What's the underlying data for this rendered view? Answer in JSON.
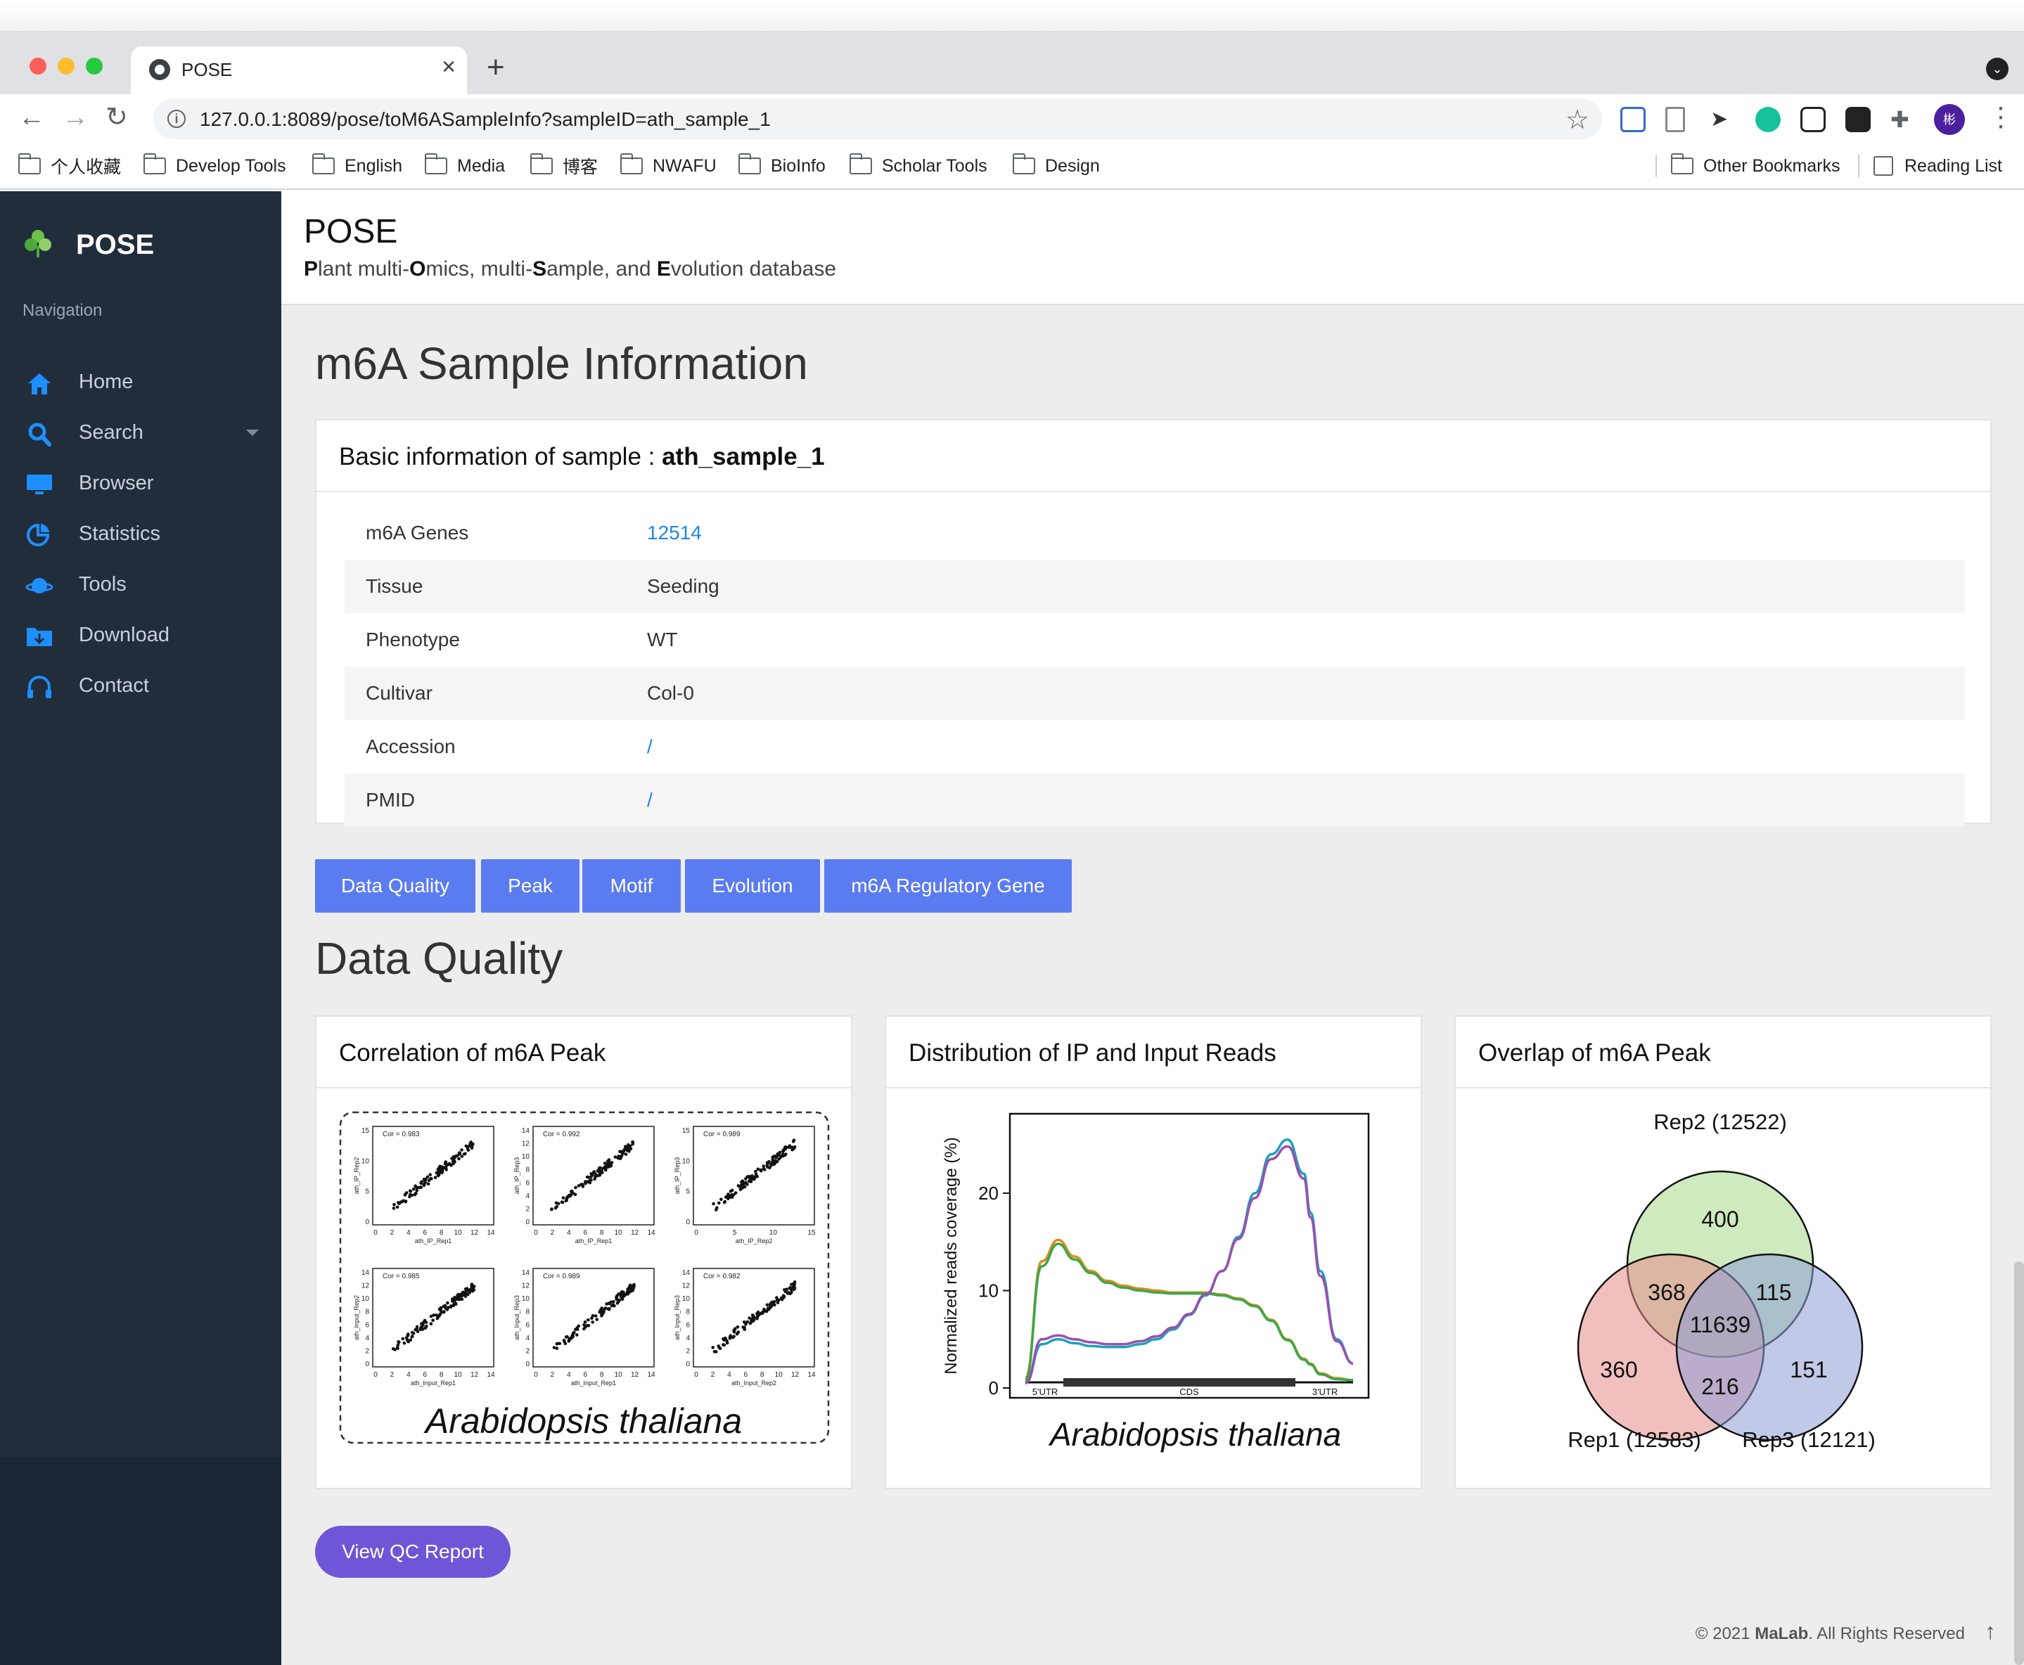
{
  "browser": {
    "tab_title": "POSE",
    "tab_close": "×",
    "new_tab": "+",
    "url": "127.0.0.1:8089/pose/toM6ASampleInfo?sampleID=ath_sample_1",
    "bookmarks": [
      "个人收藏",
      "Develop Tools",
      "English",
      "Media",
      "博客",
      "NWAFU",
      "BioInfo",
      "Scholar Tools",
      "Design"
    ],
    "other_bookmarks": "Other Bookmarks",
    "reading_list": "Reading List",
    "profile_initial": "彬"
  },
  "sidebar": {
    "brand": "POSE",
    "nav_heading": "Navigation",
    "items": [
      {
        "label": "Home",
        "icon": "home-icon"
      },
      {
        "label": "Search",
        "icon": "search-icon"
      },
      {
        "label": "Browser",
        "icon": "monitor-icon"
      },
      {
        "label": "Statistics",
        "icon": "pie-chart-icon"
      },
      {
        "label": "Tools",
        "icon": "planet-icon"
      },
      {
        "label": "Download",
        "icon": "download-icon"
      },
      {
        "label": "Contact",
        "icon": "headphones-icon"
      }
    ]
  },
  "header": {
    "title": "POSE",
    "subtitle_parts": [
      {
        "text": "P",
        "bold": true
      },
      {
        "text": "lant multi-",
        "bold": false
      },
      {
        "text": "O",
        "bold": true
      },
      {
        "text": "mics, multi-",
        "bold": false
      },
      {
        "text": "S",
        "bold": true
      },
      {
        "text": "ample, and ",
        "bold": false
      },
      {
        "text": "E",
        "bold": true
      },
      {
        "text": "volution database",
        "bold": false
      }
    ]
  },
  "page": {
    "title": "m6A Sample Information",
    "info_card_title_prefix": "Basic information of sample : ",
    "sample_id": "ath_sample_1",
    "rows": [
      {
        "key": "m6A Genes",
        "value": "12514",
        "link": true
      },
      {
        "key": "Tissue",
        "value": "Seeding",
        "link": false
      },
      {
        "key": "Phenotype",
        "value": "WT",
        "link": false
      },
      {
        "key": "Cultivar",
        "value": "Col-0",
        "link": false
      },
      {
        "key": "Accession",
        "value": "/",
        "link": true
      },
      {
        "key": "PMID",
        "value": "/",
        "link": true
      }
    ],
    "buttons": [
      "Data Quality",
      "Peak",
      "Motif",
      "Evolution",
      "m6A Regulatory Gene"
    ],
    "section_title": "Data Quality",
    "qc_button": "View QC Report"
  },
  "figures": {
    "correlation": {
      "card_title": "Correlation of m6A Peak",
      "species": "Arabidopsis thaliana",
      "panels": [
        {
          "cor": "Cor = 0.983",
          "xlabel": "ath_IP_Rep1",
          "ylabel": "ath_IP_Rep2",
          "xticks": [
            "0",
            "2",
            "4",
            "6",
            "8",
            "10",
            "12",
            "14"
          ],
          "yticks": [
            "15",
            "10",
            "5",
            "0"
          ]
        },
        {
          "cor": "Cor = 0.992",
          "xlabel": "ath_IP_Rep1",
          "ylabel": "ath_IP_Rep3",
          "xticks": [
            "0",
            "2",
            "4",
            "6",
            "8",
            "10",
            "12",
            "14"
          ],
          "yticks": [
            "14",
            "12",
            "10",
            "8",
            "6",
            "4",
            "2",
            "0"
          ]
        },
        {
          "cor": "Cor = 0.989",
          "xlabel": "ath_IP_Rep2",
          "ylabel": "ath_IP_Rep3",
          "xticks": [
            "0",
            "5",
            "10",
            "15"
          ],
          "yticks": [
            "15",
            "10",
            "5",
            "0"
          ]
        },
        {
          "cor": "Cor = 0.985",
          "xlabel": "ath_Input_Rep1",
          "ylabel": "ath_Input_Rep2",
          "xticks": [
            "0",
            "2",
            "4",
            "6",
            "8",
            "10",
            "12",
            "14"
          ],
          "yticks": [
            "14",
            "12",
            "10",
            "8",
            "6",
            "4",
            "2",
            "0"
          ]
        },
        {
          "cor": "Cor = 0.989",
          "xlabel": "ath_Input_Rep1",
          "ylabel": "ath_Input_Rep3",
          "xticks": [
            "0",
            "2",
            "4",
            "6",
            "8",
            "10",
            "12",
            "14"
          ],
          "yticks": [
            "14",
            "12",
            "10",
            "8",
            "6",
            "4",
            "2",
            "0"
          ]
        },
        {
          "cor": "Cor = 0.982",
          "xlabel": "ath_Input_Rep2",
          "ylabel": "ath_Input_Rep3",
          "xticks": [
            "0",
            "2",
            "4",
            "6",
            "8",
            "10",
            "12",
            "14"
          ],
          "yticks": [
            "14",
            "12",
            "10",
            "8",
            "6",
            "4",
            "2",
            "0"
          ]
        }
      ]
    },
    "distribution": {
      "card_title": "Distribution of IP and Input Reads",
      "species": "Arabidopsis thaliana"
    },
    "overlap": {
      "card_title": "Overlap of m6A Peak"
    }
  },
  "chart_data": [
    {
      "type": "line",
      "title": "Distribution of IP and Input Reads",
      "ylabel": "Normalized reads coverage (%)",
      "xlabel": "",
      "x_regions": [
        "5'UTR",
        "CDS",
        "3'UTR"
      ],
      "ylim": [
        0,
        27
      ],
      "yticks": [
        0,
        10,
        20
      ],
      "x": [
        0,
        0.05,
        0.1,
        0.15,
        0.2,
        0.25,
        0.3,
        0.35,
        0.4,
        0.45,
        0.5,
        0.55,
        0.6,
        0.65,
        0.7,
        0.75,
        0.8,
        0.85,
        0.87,
        0.9,
        0.95,
        1.0
      ],
      "series": [
        {
          "color": "#e08a1e",
          "values": [
            1,
            13,
            15.2,
            13.5,
            12,
            11,
            10.5,
            10.2,
            10,
            9.8,
            9.8,
            9.8,
            9.6,
            9.2,
            8.5,
            7,
            5,
            3,
            2.5,
            1.5,
            1,
            0.8
          ]
        },
        {
          "color": "#3aa84a",
          "values": [
            0.8,
            12.5,
            14.8,
            13.2,
            11.8,
            10.8,
            10.3,
            10,
            9.8,
            9.7,
            9.7,
            9.7,
            9.5,
            9.1,
            8.4,
            6.9,
            4.9,
            2.9,
            2.4,
            1.4,
            0.9,
            0.8
          ]
        },
        {
          "color": "#1aa3b8",
          "values": [
            0.5,
            4.5,
            5,
            4.6,
            4.3,
            4.2,
            4.2,
            4.5,
            5,
            6,
            7.5,
            9.5,
            12,
            15.5,
            20,
            24,
            25.5,
            22,
            18,
            12,
            5,
            2.5
          ]
        },
        {
          "color": "#9b4fae",
          "values": [
            0.5,
            5,
            5.4,
            5,
            4.7,
            4.5,
            4.5,
            4.8,
            5.3,
            6.2,
            7.6,
            9.6,
            12,
            15.3,
            19.5,
            23.5,
            24.8,
            21.5,
            17.5,
            11.5,
            4.8,
            2.5
          ]
        }
      ]
    },
    {
      "type": "venn",
      "title": "Overlap of m6A Peak",
      "sets": [
        {
          "name": "Rep2 (12522)",
          "color": "#a8d88a"
        },
        {
          "name": "Rep1 (12583)",
          "color": "#e88a8a"
        },
        {
          "name": "Rep3 (12121)",
          "color": "#8c9dd6"
        }
      ],
      "regions": {
        "Rep2_only": 400,
        "Rep1_only": 360,
        "Rep3_only": 151,
        "Rep1_Rep2": 368,
        "Rep2_Rep3": 115,
        "Rep1_Rep3": 216,
        "all": 11639
      }
    }
  ],
  "footer": {
    "prefix": "© 2021 ",
    "org": "MaLab",
    "suffix": ". All Rights Reserved",
    "to_top": "↑"
  }
}
